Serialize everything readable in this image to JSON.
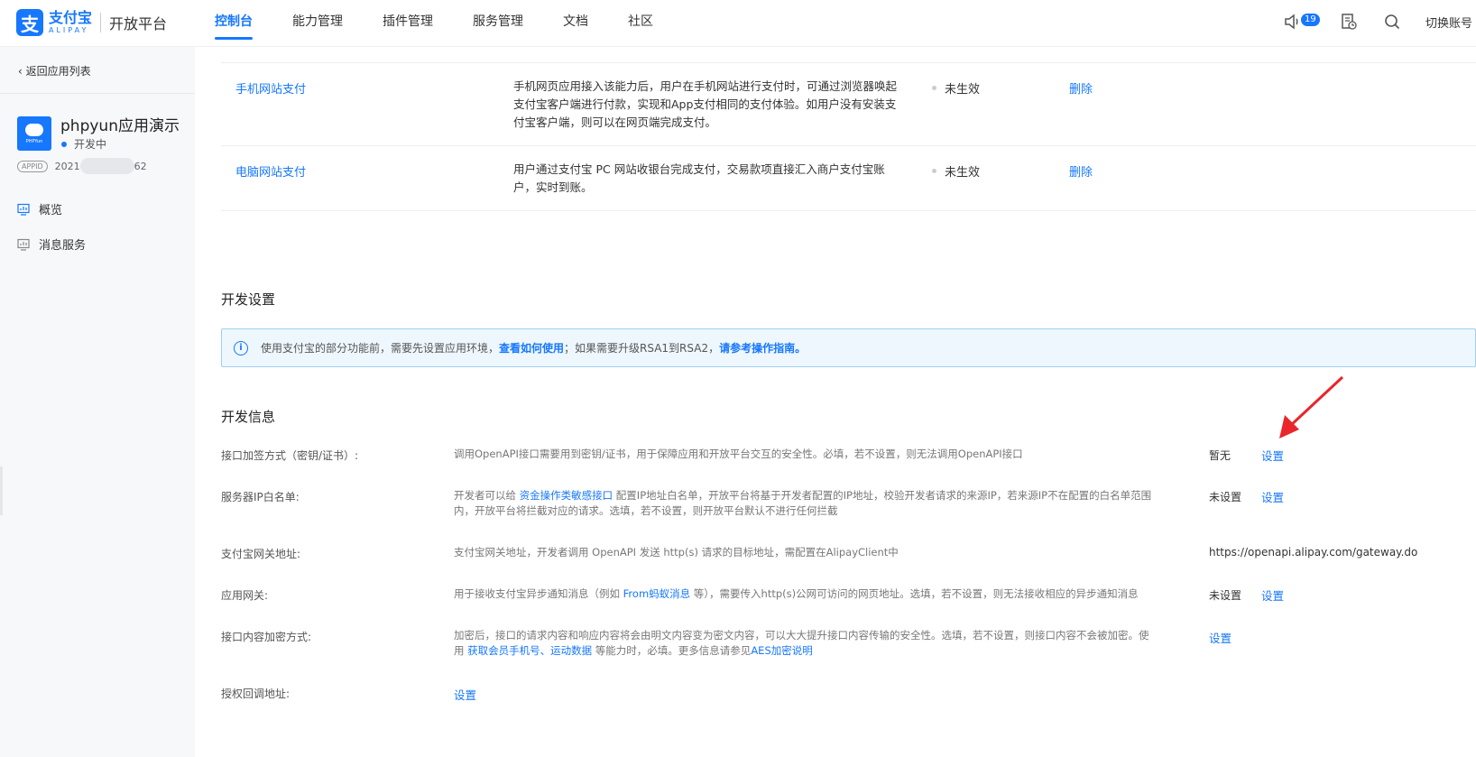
{
  "header": {
    "logo_mark": "支",
    "logo_cn": "支付宝",
    "logo_en": "ALIPAY",
    "platform": "开放平台",
    "nav": [
      "控制台",
      "能力管理",
      "插件管理",
      "服务管理",
      "文档",
      "社区"
    ],
    "notification_count": "19",
    "switch_account": "切换账号"
  },
  "sidebar": {
    "back": "返回应用列表",
    "app_name": "phpyun应用演示",
    "app_status": "开发中",
    "app_icon_text": "PHPYun",
    "appid_tag": "APPID",
    "appid_prefix": "2021",
    "appid_suffix": "62",
    "items": [
      "概览",
      "消息服务"
    ]
  },
  "capabilities": [
    {
      "name": "手机网站支付",
      "desc": "手机网页应用接入该能力后，用户在手机网站进行支付时，可通过浏览器唤起支付宝客户端进行付款，实现和App支付相同的支付体验。如用户没有安装支付宝客户端，则可以在网页端完成支付。",
      "status": "未生效",
      "action": "删除"
    },
    {
      "name": "电脑网站支付",
      "desc": "用户通过支付宝 PC 网站收银台完成支付，交易款项直接汇入商户支付宝账户，实时到账。",
      "status": "未生效",
      "action": "删除"
    }
  ],
  "dev_settings": {
    "title": "开发设置",
    "alert_text1": "使用支付宝的部分功能前，需要先设置应用环境，",
    "alert_link1": "查看如何使用",
    "alert_text2": "；如果需要升级RSA1到RSA2，",
    "alert_link2": "请参考操作指南。"
  },
  "dev_info": {
    "title": "开发信息",
    "sign": {
      "label": "接口加签方式（密钥/证书）:",
      "desc": "调用OpenAPI接口需要用到密钥/证书，用于保障应用和开放平台交互的安全性。必填，若不设置，则无法调用OpenAPI接口",
      "value": "暂无",
      "action": "设置"
    },
    "ip": {
      "label": "服务器IP白名单:",
      "desc_a": "开发者可以给 ",
      "desc_link": "资金操作类敏感接口",
      "desc_b": " 配置IP地址白名单，开放平台将基于开发者配置的IP地址，校验开发者请求的来源IP，若来源IP不在配置的白名单范围内，开放平台将拦截对应的请求。选填，若不设置，则开放平台默认不进行任何拦截",
      "value": "未设置",
      "action": "设置"
    },
    "gateway": {
      "label": "支付宝网关地址:",
      "desc": "支付宝网关地址，开发者调用 OpenAPI 发送 http(s) 请求的目标地址，需配置在AlipayClient中",
      "value": "https://openapi.alipay.com/gateway.do"
    },
    "app_gateway": {
      "label": "应用网关:",
      "desc_a": "用于接收支付宝异步通知消息（例如 ",
      "desc_link": "From蚂蚁消息",
      "desc_b": " 等），需要传入http(s)公网可访问的网页地址。选填，若不设置，则无法接收相应的异步通知消息",
      "value": "未设置",
      "action": "设置"
    },
    "encrypt": {
      "label": "接口内容加密方式:",
      "desc_a": "加密后，接口的请求内容和响应内容将会由明文内容变为密文内容，可以大大提升接口内容传输的安全性。选填，若不设置，则接口内容不会被加密。使用 ",
      "desc_link1": "获取会员手机号",
      "desc_sep": "、",
      "desc_link2": "运动数据",
      "desc_b": " 等能力时，必填。更多信息请参见",
      "desc_link3": "AES加密说明",
      "action": "设置"
    },
    "callback": {
      "label": "授权回调地址:",
      "action": "设置"
    }
  },
  "colors": {
    "accent": "#1677ff",
    "arrow": "#e8262b",
    "alert_bg": "#eef7fd"
  }
}
